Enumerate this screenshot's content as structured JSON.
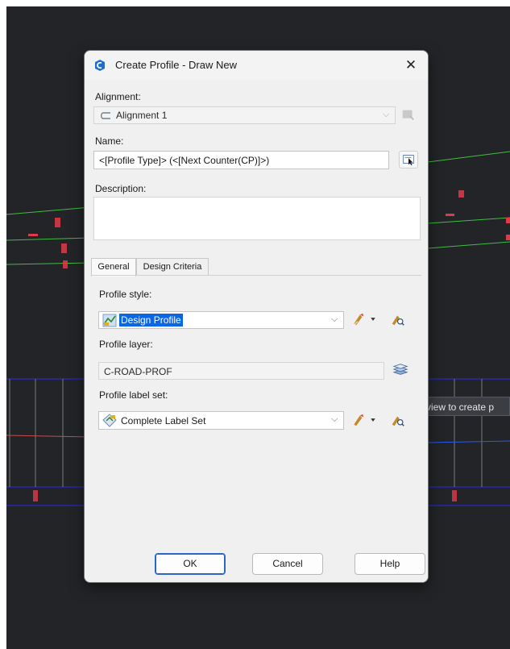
{
  "background": {
    "tooltip_text": "view to create p"
  },
  "dialog": {
    "title": "Create Profile - Draw New",
    "close_glyph": "✕",
    "alignment_label": "Alignment:",
    "alignment_value": "Alignment 1",
    "name_label": "Name:",
    "name_value": "<[Profile Type]> (<[Next Counter(CP)]>)",
    "description_label": "Description:",
    "description_value": "",
    "tabs": [
      {
        "label": "General",
        "active": true
      },
      {
        "label": "Design Criteria",
        "active": false
      }
    ],
    "general": {
      "profile_style_label": "Profile style:",
      "profile_style_value": "Design Profile",
      "profile_layer_label": "Profile layer:",
      "profile_layer_value": "C-ROAD-PROF",
      "label_set_label": "Profile label set:",
      "label_set_value": "Complete Label Set"
    },
    "buttons": {
      "ok": "OK",
      "cancel": "Cancel",
      "help": "Help"
    }
  },
  "colors": {
    "accent_blue": "#0a66e4",
    "cad_background": "#222427",
    "cad_green": "#3fbf3f",
    "cad_blue": "#2a2ae8",
    "cad_red": "#e03a4a"
  },
  "icons": [
    "app-icon",
    "alignment-icon",
    "chevron-down-icon",
    "pick-from-drawing-icon",
    "edit-name-template-icon",
    "profile-style-icon",
    "edit-style-icon",
    "zoom-style-icon",
    "layer-icon",
    "label-set-icon"
  ]
}
